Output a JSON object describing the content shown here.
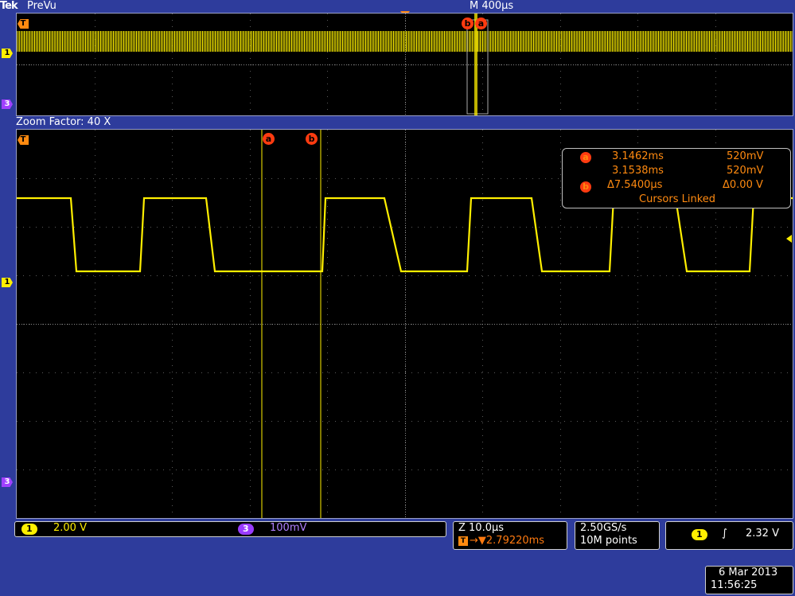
{
  "header": {
    "brand": "Tek",
    "mode": "PreVu",
    "timebase": "M 400μs"
  },
  "zoom": {
    "label": "Zoom Factor: 40 X"
  },
  "markers": {
    "trigger": "T",
    "ch1": "1",
    "ch3": "3",
    "cursor_a": "a",
    "cursor_b": "b"
  },
  "readout": {
    "a_time": "3.1462ms",
    "a_volt": "520mV",
    "b_time": "3.1538ms",
    "b_volt": "520mV",
    "delta_time": "Δ7.5400μs",
    "delta_volt": "Δ0.00 V",
    "linked": "Cursors Linked"
  },
  "status": {
    "ch1_label": "1",
    "ch1_scale": "2.00 V",
    "ch3_label": "3",
    "ch3_scale": "100mV",
    "zoom_scale": "Z 10.0μs",
    "trigger_pos": "→▼2.79220ms",
    "sample_rate": "2.50GS/s",
    "record_length": "10M points",
    "trig_ch": "1",
    "trig_slope": "∫",
    "trig_level": "2.32 V",
    "date": "6 Mar 2013",
    "time": "11:56:25"
  },
  "colors": {
    "background": "#2e3c9c",
    "trace": "#ffef00",
    "cursor": "#ff3b10",
    "trigger": "#ff8a10",
    "ch3": "#9a3cff"
  }
}
